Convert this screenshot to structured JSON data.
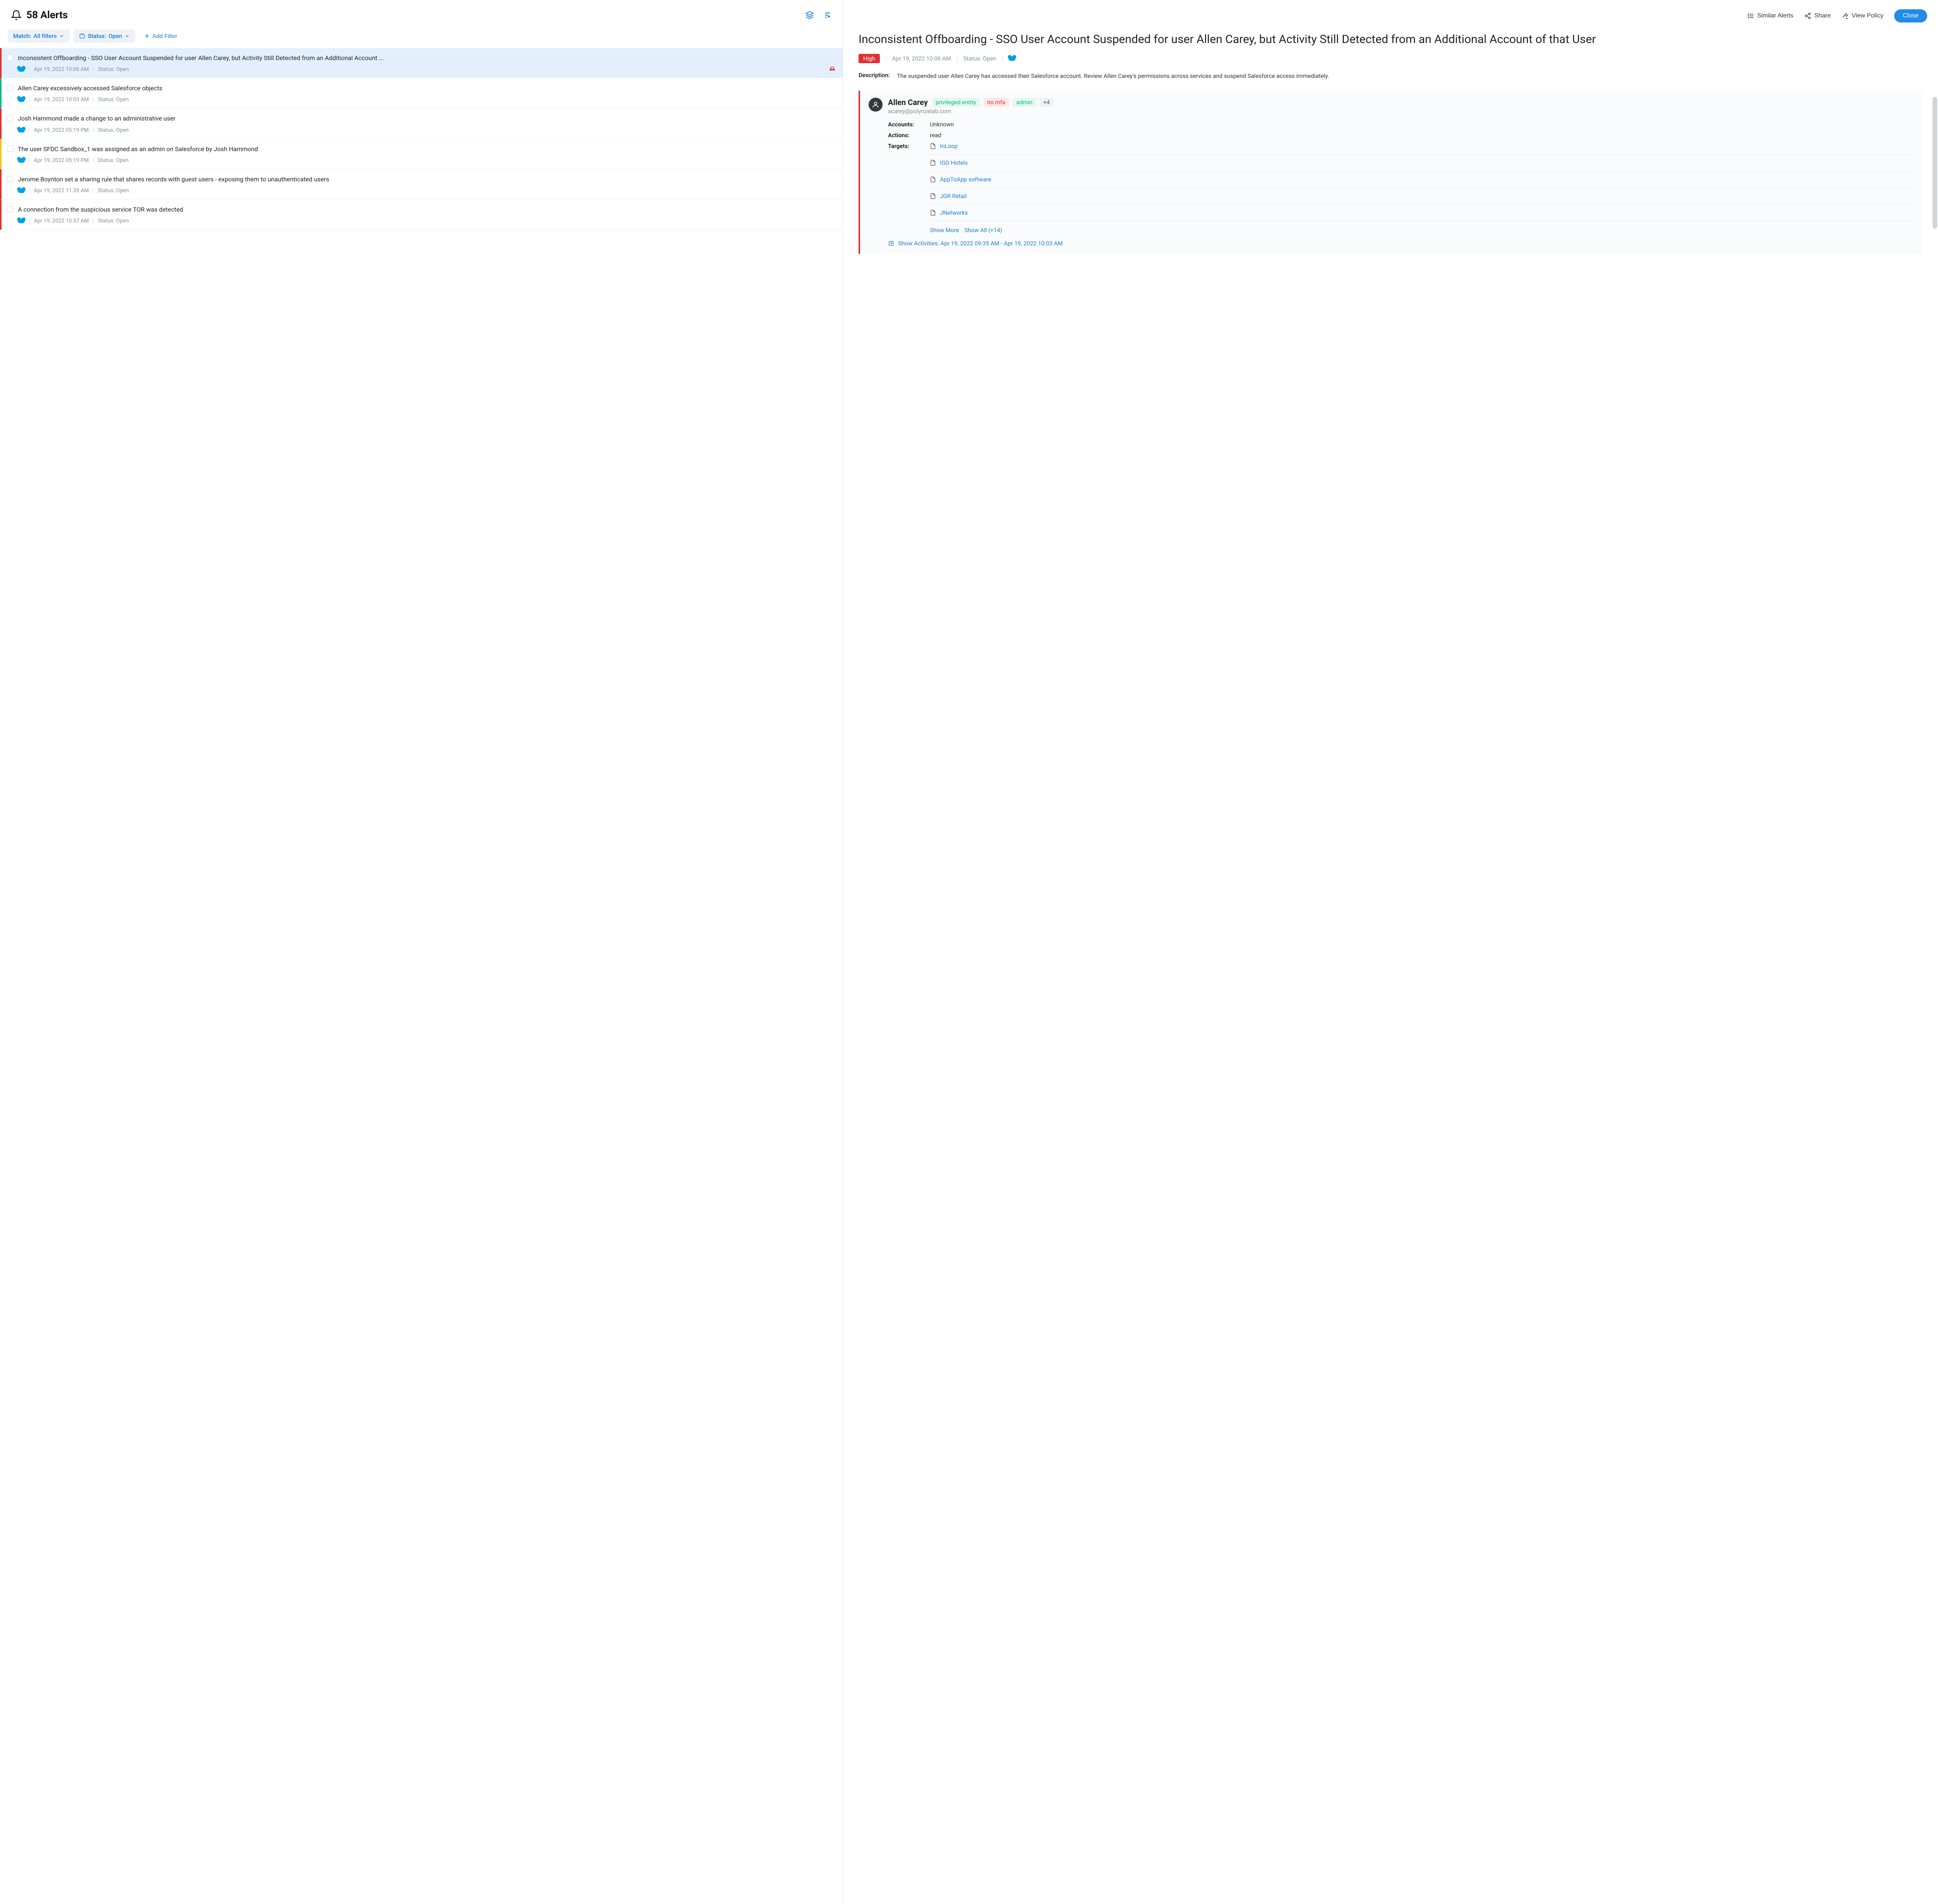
{
  "header": {
    "title": "58 Alerts"
  },
  "filters": {
    "match": {
      "label": "Match:",
      "value": "All filters"
    },
    "status": {
      "label": "Status:",
      "value": "Open"
    },
    "add": "Add Filter"
  },
  "alerts": [
    {
      "title": "Inconsistent Offboarding - SSO User Account Suspended for user Allen Carey, but Activity Still Detected from an Additional Account ...",
      "date": "Apr 19, 2022 10:06 AM",
      "status": "Status: Open",
      "sev": "high",
      "selected": true,
      "investigating": true
    },
    {
      "title": "Allen Carey excessively accessed Salesforce objects",
      "date": "Apr 19, 2022 10:03 AM",
      "status": "Status: Open",
      "sev": "low",
      "selected": false
    },
    {
      "title": "Josh Hammond made a change to an administrative user",
      "date": "Apr 19, 2022 05:19 PM",
      "status": "Status: Open",
      "sev": "high",
      "selected": false
    },
    {
      "title": "The user SFDC Sandbox_1 was assigned as an admin on Salesforce by Josh Hammond",
      "date": "Apr 19, 2022 05:19 PM",
      "status": "Status: Open",
      "sev": "med",
      "selected": false
    },
    {
      "title": "Jerome Boynton set a sharing rule that shares records with guest users - exposing them to unauthenticated users",
      "date": "Apr 19, 2022 11:39 AM",
      "status": "Status: Open",
      "sev": "high",
      "selected": false
    },
    {
      "title": "A connection from the suspicious service TOR was detected",
      "date": "Apr 19, 2022 10:37 AM",
      "status": "Status: Open",
      "sev": "high",
      "selected": false
    }
  ],
  "detail": {
    "actions": {
      "similar": "Similar Alerts",
      "share": "Share",
      "view_policy": "View Policy",
      "close": "Close"
    },
    "title": "Inconsistent Offboarding - SSO User Account Suspended for user Allen Carey, but Activity Still Detected from an Additional Account of that User",
    "severity": "High",
    "date": "Apr 19, 2022 10:06 AM",
    "status": "Status: Open",
    "description_label": "Description:",
    "description": "The suspended user Allen Carey has accessed their Salesforce account. Review Allen Carey's permissions across services and suspend Salesforce access immediately.",
    "entity": {
      "name": "Allen Carey",
      "email": "acarey@polyrizelab.com",
      "tags": [
        {
          "text": "privileged entity",
          "cls": "green"
        },
        {
          "text": "no mfa",
          "cls": "red"
        },
        {
          "text": "admin",
          "cls": "green"
        },
        {
          "text": "+4",
          "cls": "more"
        }
      ],
      "accounts_label": "Accounts:",
      "accounts_value": "Unknown",
      "actions_label": "Actions:",
      "actions_value": "read",
      "targets_label": "Targets:",
      "targets": [
        "InLoop",
        "IGG Hotels",
        "AppToApp software",
        "JGR Retail",
        "JNetworks"
      ],
      "show_more": "Show More",
      "show_all": "Show All (+14)",
      "activities": "Show Activities: Apr 19, 2022 09:35 AM - Apr 19, 2022 10:03 AM"
    }
  }
}
